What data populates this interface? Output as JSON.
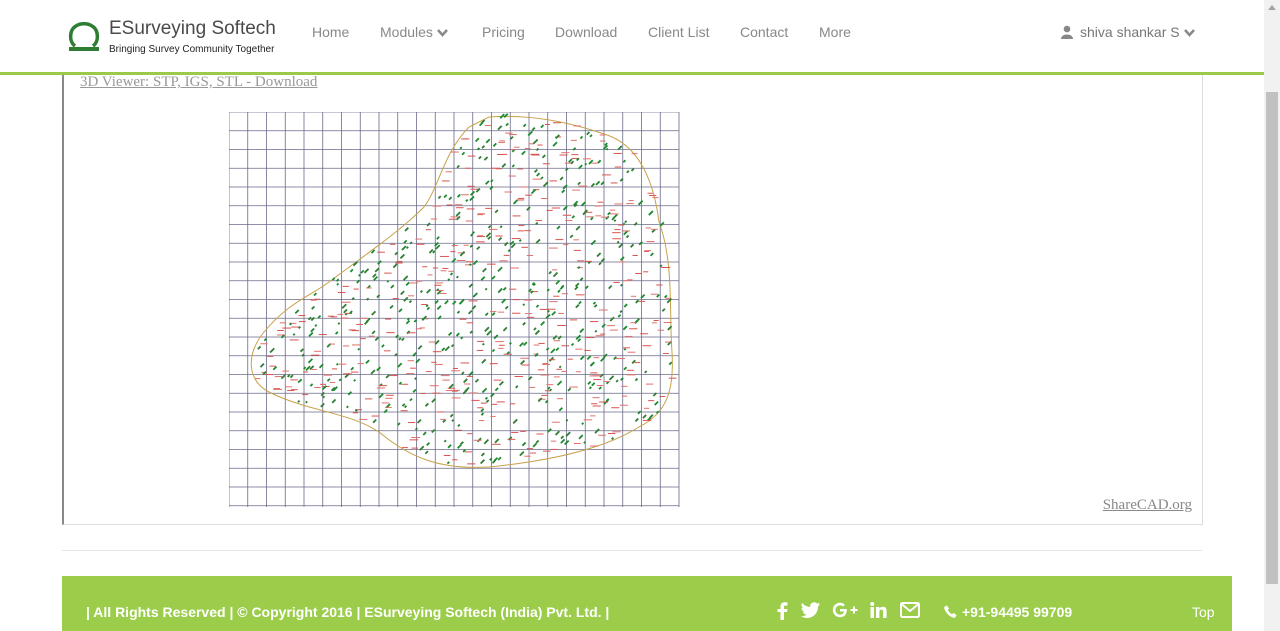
{
  "header": {
    "logo_title": "ESurveying Softech",
    "logo_tagline": "Bringing Survey Community Together",
    "nav": [
      {
        "label": "Home"
      },
      {
        "label": "Modules",
        "has_dropdown": true
      },
      {
        "label": "Pricing"
      },
      {
        "label": "Download"
      },
      {
        "label": "Client List"
      },
      {
        "label": "Contact"
      },
      {
        "label": "More"
      }
    ],
    "user_name": "shiva shankar S",
    "user_icon": "user-icon",
    "accent_color": "#9bca4b"
  },
  "viewer": {
    "link_text": "3D Viewer: STP, IGS, STL - Download",
    "brand_link": "ShareCAD.org"
  },
  "footer": {
    "copyright": "| All Rights Reserved | © Copyright 2016 | ESurveying Softech (India) Pvt. Ltd. |",
    "social_icons": [
      "facebook-icon",
      "twitter-icon",
      "google-plus-icon",
      "linkedin-icon",
      "envelope-icon"
    ],
    "phone": "+91-94495 99709",
    "top_link": "Top",
    "background_color": "#9bcd4a"
  }
}
